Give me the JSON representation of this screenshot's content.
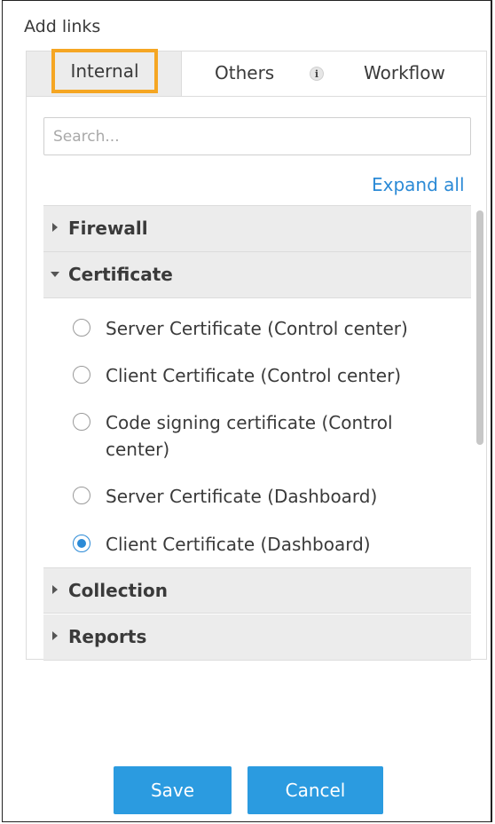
{
  "dialog": {
    "title": "Add links"
  },
  "tabs": [
    {
      "label": "Internal",
      "selected": true
    },
    {
      "label": "Others",
      "icon": "info-icon"
    },
    {
      "label": "Workflow"
    }
  ],
  "search": {
    "placeholder": "Search...",
    "value": ""
  },
  "expand_all_label": "Expand all",
  "groups": [
    {
      "label": "Firewall",
      "expanded": false
    },
    {
      "label": "Certificate",
      "expanded": true,
      "options": [
        {
          "label": "Server Certificate (Control center)",
          "checked": false
        },
        {
          "label": "Client Certificate (Control center)",
          "checked": false
        },
        {
          "label": "Code signing certificate (Control center)",
          "checked": false
        },
        {
          "label": "Server Certificate (Dashboard)",
          "checked": false
        },
        {
          "label": "Client Certificate (Dashboard)",
          "checked": true
        }
      ]
    },
    {
      "label": "Collection",
      "expanded": false
    },
    {
      "label": "Reports",
      "expanded": false
    }
  ],
  "buttons": {
    "save_label": "Save",
    "cancel_label": "Cancel"
  },
  "colors": {
    "accent": "#2b9be0",
    "link": "#2b8ad6",
    "highlight": "#f5a623",
    "header_bg": "#ececec"
  }
}
